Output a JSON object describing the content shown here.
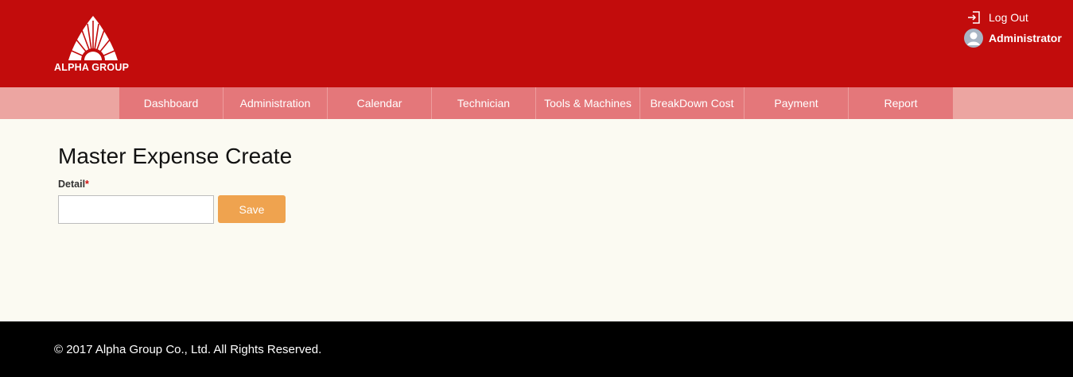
{
  "brand": {
    "name": "ALPHA GROUP",
    "logo_icon": "alpha-group-logo"
  },
  "colors": {
    "header": "#c20c0c",
    "nav_bar": "#eca5a1",
    "nav_item": "#e4777a",
    "save_button": "#efa34f",
    "footer": "#000000",
    "page_background": "#fbfaf2"
  },
  "user_menu": {
    "logout_label": "Log Out",
    "logout_icon": "logout-icon",
    "username": "Administrator",
    "avatar_icon": "user-avatar-icon"
  },
  "nav": {
    "items": [
      {
        "label": "Dashboard"
      },
      {
        "label": "Administration"
      },
      {
        "label": "Calendar"
      },
      {
        "label": "Technician"
      },
      {
        "label": "Tools & Machines"
      },
      {
        "label": "BreakDown Cost"
      },
      {
        "label": "Payment"
      },
      {
        "label": "Report"
      }
    ]
  },
  "page": {
    "title": "Master Expense Create",
    "form": {
      "detail_label": "Detail",
      "required_marker": "*",
      "detail_value": "",
      "save_label": "Save"
    }
  },
  "footer": {
    "copyright": "© 2017 Alpha Group Co., Ltd. All Rights Reserved."
  }
}
